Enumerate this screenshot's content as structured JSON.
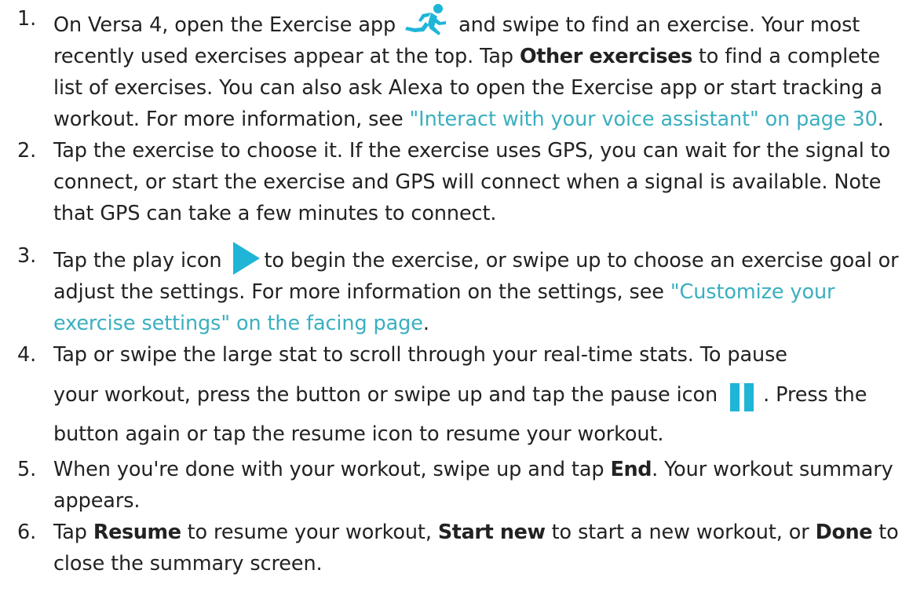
{
  "steps": [
    {
      "number": "1.",
      "text_a": "On Versa 4, open the Exercise app",
      "icon": "running-person-icon",
      "text_b": " and swipe to find an exercise. Your most recently used exercises appear at the top. Tap ",
      "bold_a": "Other exercises",
      "text_c": " to find a complete list of exercises. You can also ask Alexa to open the Exercise app or start tracking a workout. For more information, see ",
      "link": "\"Interact with your voice assistant\" on page 30",
      "text_d": "."
    },
    {
      "number": "2.",
      "text": "Tap the exercise to choose it. If the exercise uses GPS, you can wait for the signal to connect, or start the exercise and GPS will connect when a signal is available. Note that GPS can take a few minutes to connect."
    },
    {
      "number": "3.",
      "text_a": "Tap the play icon ",
      "icon": "play-icon",
      "text_b": "to begin the exercise, or swipe up to choose an exercise goal or adjust the settings. For more information on the settings, see ",
      "link": "\"Customize your exercise settings\" on the facing page",
      "text_c": "."
    },
    {
      "number": "4.",
      "text_a": "Tap or swipe the large stat to scroll through your real-time stats. To pause",
      "text_b": "your workout, press the button or swipe up and tap the pause icon",
      "icon": "pause-icon",
      "text_c": ". Press the button again or tap the resume icon to resume your workout."
    },
    {
      "number": "5.",
      "text_a": "When you're done with your workout, swipe up and tap ",
      "bold_a": "End",
      "text_b": ". Your workout summary appears."
    },
    {
      "number": "6.",
      "text_a": "Tap ",
      "bold_a": "Resume",
      "text_b": " to resume your workout, ",
      "bold_b": "Start new",
      "text_c": " to start a new workout, or ",
      "bold_c": "Done",
      "text_d": " to close the summary screen."
    }
  ],
  "colors": {
    "link": "#3aafc0",
    "icon_accent": "#1fb5d6",
    "text": "#222222"
  }
}
